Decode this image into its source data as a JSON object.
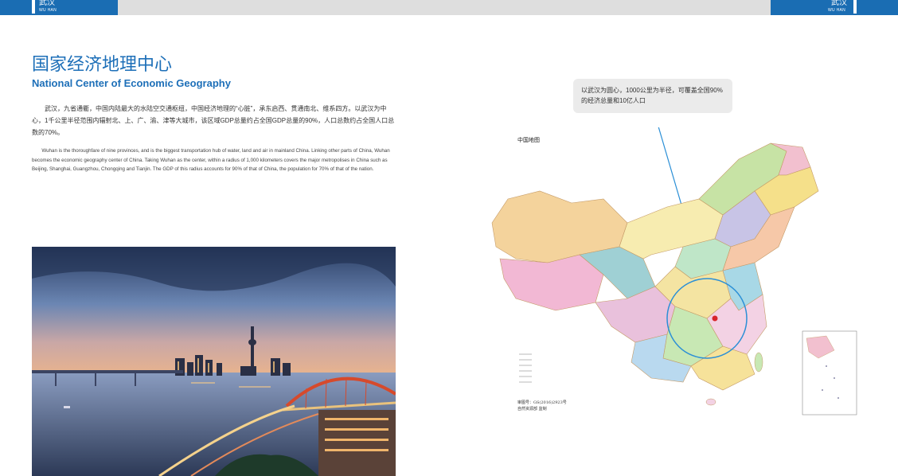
{
  "header": {
    "left_tag": {
      "cn": "武汉",
      "en": "WU HAN"
    },
    "right_tag": {
      "cn": "武汉",
      "en": "WU HAN"
    },
    "accent_color": "#1a6db3"
  },
  "title": {
    "cn": "国家经济地理中心",
    "en": "National Center of Economic Geography"
  },
  "body": {
    "cn": "武汉，九省通衢，中国内陆最大的水陆空交通枢纽，中国经济地理的“心脏”，承东启西、贯通南北、维系四方。以武汉为中心，1千公里半径范围内辐射北、上、广、渝、津等大城市，该区域GDP总量约占全国GDP总量的90%，人口总数约占全国人口总数的70%。",
    "en": "Wuhan is the thoroughfare of nine provinces, and is the biggest transportation hub of water, land and air in mainland China. Linking other parts of China, Wuhan becomes the economic geography center of China. Taking Wuhan as the center, within a radius of 1,000 kilometers covers the major metropolises in China such as Beijing, Shanghai, Guangzhou, Chongqing and Tianjin. The GDP of this radius accounts for 90% of that of China, the population for 70% of that of the nation."
  },
  "map": {
    "label": "中国地图",
    "callout": "以武汉为圆心，1000公里为半径，可覆盖全国90%的经济总量和10亿人口",
    "approval_line1": "审图号：GS(2016)2923号",
    "approval_line2": "自然资源部 监制",
    "circle_color": "#2b8fd6",
    "marker_color": "#d7262b"
  }
}
